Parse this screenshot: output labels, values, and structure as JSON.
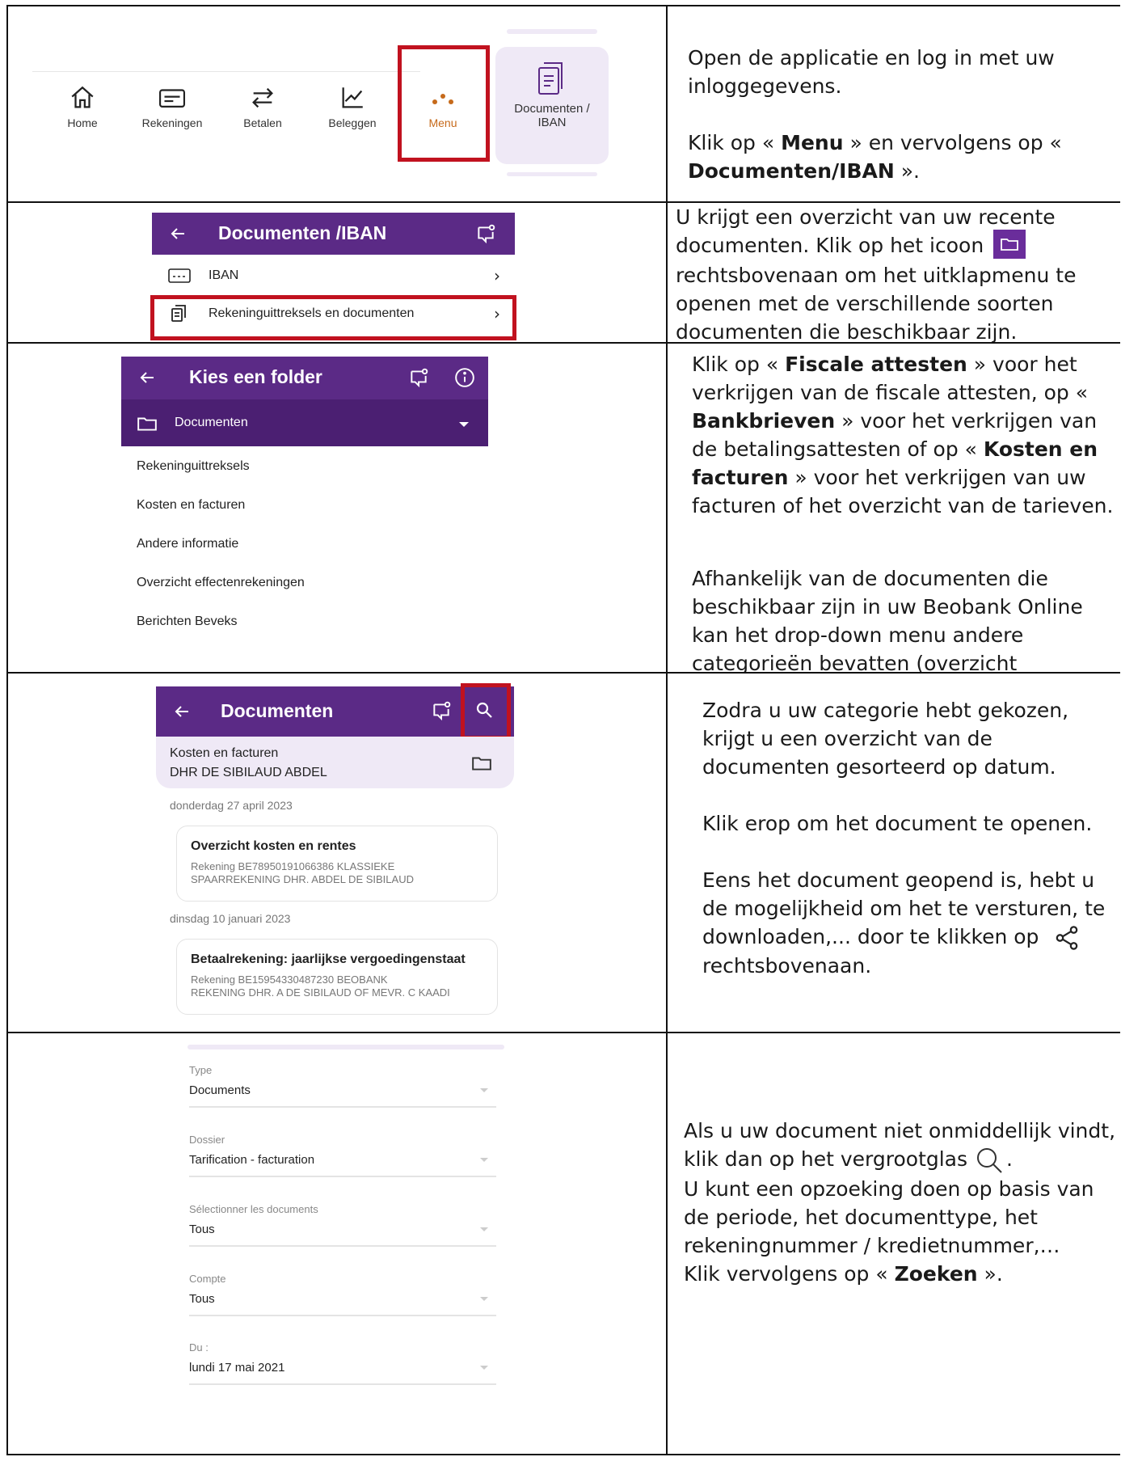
{
  "row1": {
    "nav": [
      {
        "label": "Home",
        "icon": "home-icon"
      },
      {
        "label": "Rekeningen",
        "icon": "card-icon"
      },
      {
        "label": "Betalen",
        "icon": "transfer-icon"
      },
      {
        "label": "Beleggen",
        "icon": "chart-icon"
      },
      {
        "label": "Menu",
        "icon": "dots-icon"
      }
    ],
    "tile_label_1": "Documenten /",
    "tile_label_2": "IBAN",
    "text": {
      "p1": "Open de applicatie en log in met uw inloggegevens.",
      "p2_pre": "Klik op « ",
      "p2_b1": "Menu",
      "p2_mid": " » en vervolgens op « ",
      "p2_b2": "Documenten/IBAN",
      "p2_end": " »."
    }
  },
  "row2": {
    "header_title": "Documenten /IBAN",
    "items": [
      "IBAN",
      "Rekeninguittreksels en documenten"
    ],
    "text": {
      "p1_a": "U krijgt een overzicht van uw recente documenten. Klik op het icoon",
      "p1_b": "rechtsbovenaan om het uitklapmenu te openen met de verschillende soorten documenten die beschikbaar zijn."
    }
  },
  "row3": {
    "header_title": "Kies een folder",
    "folder_label": "Documenten",
    "items": [
      "Rekeninguittreksels",
      "Kosten en facturen",
      "Andere informatie",
      "Overzicht effectenrekeningen",
      "Berichten Beveks"
    ],
    "text": {
      "a1": "Klik op « ",
      "b1": "Fiscale attesten",
      "a2": " » voor het verkrijgen van de fiscale attesten, op « ",
      "b2": "Bankbrieven",
      "a3": " »  voor het verkrijgen van de betalingsattesten of op  « ",
      "b3": "Kosten en facturen",
      "a4": " » voor het verkrijgen van uw facturen of het overzicht van de tarieven.",
      "p2": "Afhankelijk van de documenten die beschikbaar zijn in uw Beobank Online kan het drop-down menu andere categorieën bevatten (overzicht effectenrekening,...)."
    }
  },
  "row4": {
    "header_title": "Documenten",
    "filter_category": "Kosten en facturen",
    "filter_owner": "DHR DE SIBILAUD ABDEL",
    "groups": [
      {
        "date": "donderdag 27 april 2023",
        "title": "Overzicht kosten en rentes",
        "sub1": "Rekening BE78950191066386 KLASSIEKE",
        "sub2": "SPAARREKENING DHR. ABDEL DE SIBILAUD"
      },
      {
        "date": "dinsdag 10 januari 2023",
        "title": "Betaalrekening: jaarlijkse vergoedingenstaat",
        "sub1": "Rekening BE15954330487230 BEOBANK",
        "sub2": "REKENING DHR. A DE SIBILAUD OF MEVR. C KAADI"
      }
    ],
    "text": {
      "p1": "Zodra u uw categorie hebt gekozen, krijgt u een overzicht van de documenten gesorteerd op datum.",
      "p2": "Klik erop om het document te openen.",
      "p3": "Eens het document geopend is, hebt u de mogelijkheid om het te versturen, te downloaden,... door te klikken op",
      "p3_end": "rechtsbovenaan."
    }
  },
  "row5": {
    "fields": [
      {
        "label": "Type",
        "value": "Documents"
      },
      {
        "label": "Dossier",
        "value": "Tarification - facturation"
      },
      {
        "label": "Sélectionner les documents",
        "value": "Tous"
      },
      {
        "label": "Compte",
        "value": "Tous"
      },
      {
        "label": "Du :",
        "value": "lundi 17 mai 2021"
      }
    ],
    "text": {
      "p1": "Als u uw document niet onmiddellijk vindt, klik dan op het vergrootglas",
      "p1_end": ".",
      "p2": "U kunt een opzoeking doen op basis van de periode, het documenttype, het rekeningnummer / kredietnummer,…",
      "p3_pre": "Klik vervolgens op « ",
      "p3_b": "Zoeken",
      "p3_end": " »."
    }
  },
  "colors": {
    "purple": "#5b2a86",
    "red_highlight": "#c1121f",
    "menu_active": "#c66a1b",
    "tile_bg": "#efe9f6"
  }
}
